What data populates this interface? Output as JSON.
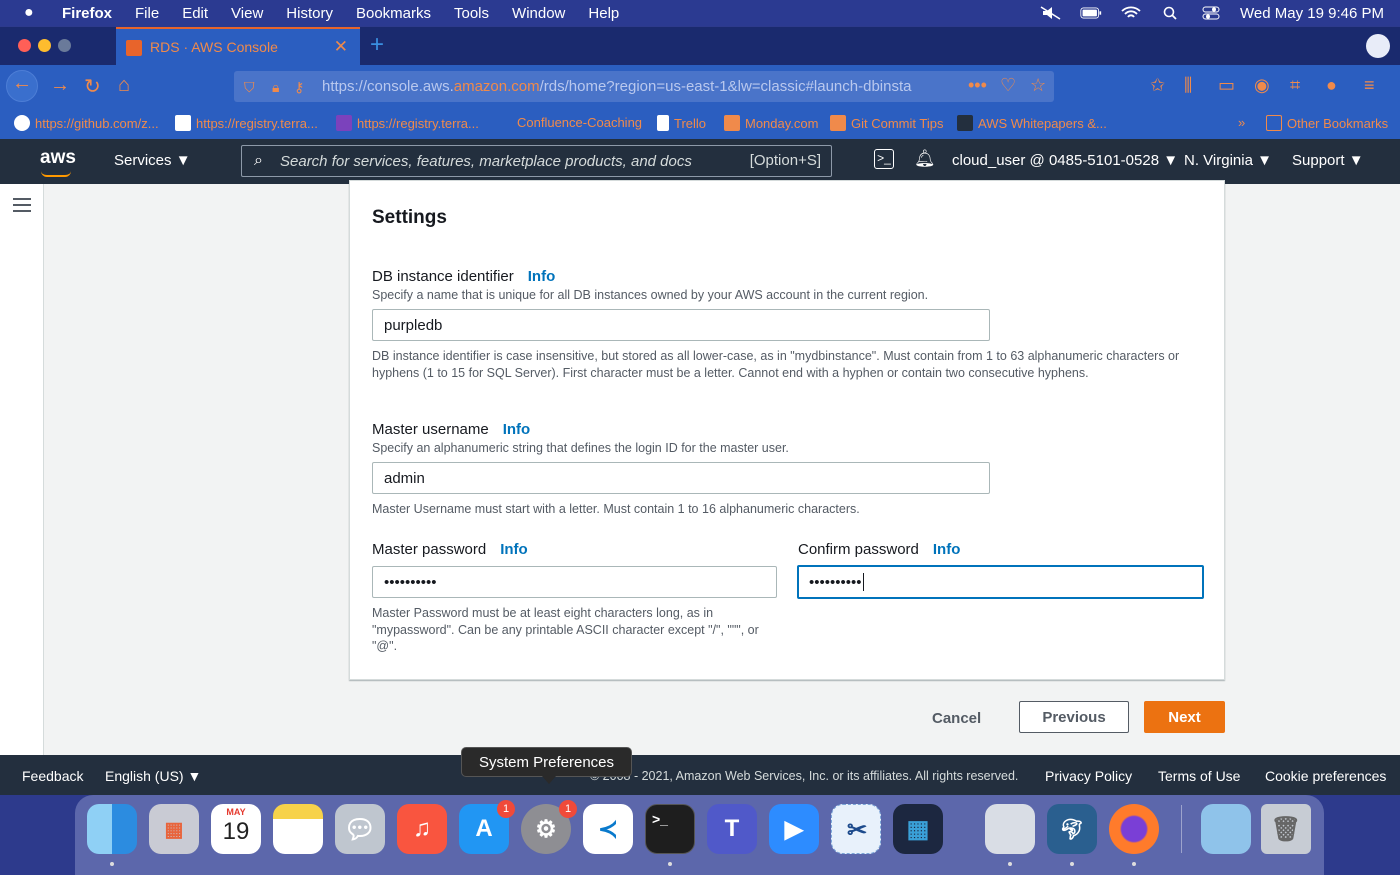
{
  "menubar": {
    "app": "Firefox",
    "items": [
      "File",
      "Edit",
      "View",
      "History",
      "Bookmarks",
      "Tools",
      "Window",
      "Help"
    ],
    "clock": "Wed May 19  9:46 PM"
  },
  "browser": {
    "tab_title": "RDS · AWS Console",
    "url_prefix": "https://console.aws.",
    "url_domain": "amazon.com",
    "url_suffix": "/rds/home?region=us-east-1&lw=classic#launch-dbinsta",
    "bookmarks": [
      "https://github.com/z...",
      "https://registry.terra...",
      "https://registry.terra...",
      "Confluence-Coaching",
      "Trello",
      "Monday.com",
      "Git Commit Tips",
      "AWS Whitepapers &..."
    ],
    "other_bookmarks": "Other Bookmarks"
  },
  "aws": {
    "logo": "aws",
    "services": "Services",
    "search_placeholder": "Search for services, features, marketplace products, and docs",
    "search_shortcut": "[Option+S]",
    "account": "cloud_user @ 0485-5101-0528",
    "region": "N. Virginia",
    "support": "Support"
  },
  "settings": {
    "title": "Settings",
    "info": "Info",
    "db_identifier": {
      "label": "DB instance identifier",
      "description": "Specify a name that is unique for all DB instances owned by your AWS account in the current region.",
      "value": "purpledb",
      "constraint": "DB instance identifier is case insensitive, but stored as all lower-case, as in \"mydbinstance\". Must contain from 1 to 63 alphanumeric characters or hyphens (1 to 15 for SQL Server). First character must be a letter. Cannot end with a hyphen or contain two consecutive hyphens."
    },
    "master_username": {
      "label": "Master username",
      "description": "Specify an alphanumeric string that defines the login ID for the master user.",
      "value": "admin",
      "constraint": "Master Username must start with a letter. Must contain 1 to 16 alphanumeric characters."
    },
    "master_password": {
      "label": "Master password",
      "value": "••••••••••",
      "constraint": "Master Password must be at least eight characters long, as in \"mypassword\". Can be any printable ASCII character except \"/\", \"\"\", or \"@\"."
    },
    "confirm_password": {
      "label": "Confirm password",
      "value": "••••••••••"
    }
  },
  "actions": {
    "cancel": "Cancel",
    "previous": "Previous",
    "next": "Next"
  },
  "footer": {
    "feedback": "Feedback",
    "language": "English (US)",
    "copyright": "© 2008 - 2021, Amazon Web Services, Inc. or its affiliates. All rights reserved.",
    "privacy": "Privacy Policy",
    "terms": "Terms of Use",
    "cookies": "Cookie preferences"
  },
  "tooltip": "System Preferences",
  "dock": {
    "calendar_month": "MAY",
    "calendar_day": "19",
    "appstore_badge": "1",
    "sysprefs_badge": "1"
  },
  "colors": {
    "aws_nav": "#232f3e",
    "primary_button": "#ec7211",
    "link": "#0073bb",
    "browser_chrome": "#2b5ec0"
  }
}
